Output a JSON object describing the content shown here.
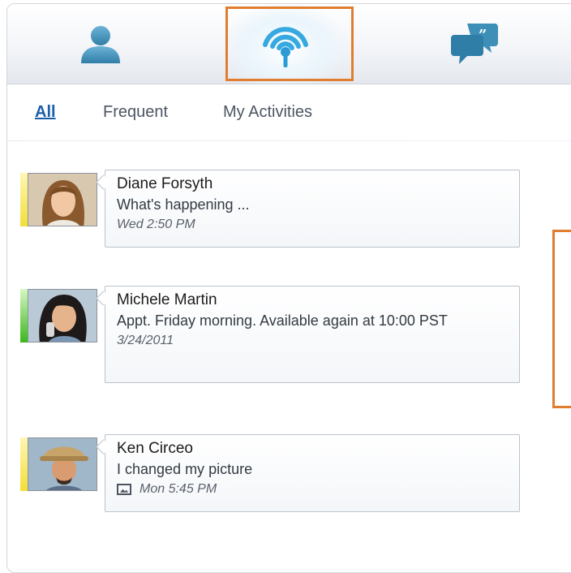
{
  "toolbar": {
    "tabs": [
      {
        "id": "contacts",
        "icon": "contacts-person-icon",
        "selected": false
      },
      {
        "id": "activity-feed",
        "icon": "activity-feed-antenna-icon",
        "selected": true
      },
      {
        "id": "conversations",
        "icon": "conversations-speech-bubble-icon",
        "selected": false
      }
    ]
  },
  "filters": {
    "all": "All",
    "frequent": "Frequent",
    "my_activities": "My Activities",
    "selected": "All"
  },
  "feed": [
    {
      "name": "Diane Forsyth",
      "message": "What's happening ...",
      "time": "Wed 2:50 PM",
      "presence": "away"
    },
    {
      "name": "Michele Martin",
      "message": "Appt. Friday morning. Available again at 10:00 PST",
      "time": "3/24/2011",
      "presence": "online"
    },
    {
      "name": "Ken Circeo",
      "message": "I changed my picture",
      "time": "Mon 5:45 PM",
      "presence": "away",
      "attachment_icon": "picture-icon"
    }
  ],
  "colors": {
    "highlight": "#e07d2f",
    "accent_link": "#1a5ea8",
    "status_away": "#f3de3a",
    "status_online": "#39b81a",
    "icon_blue": "#3d8fb8"
  }
}
